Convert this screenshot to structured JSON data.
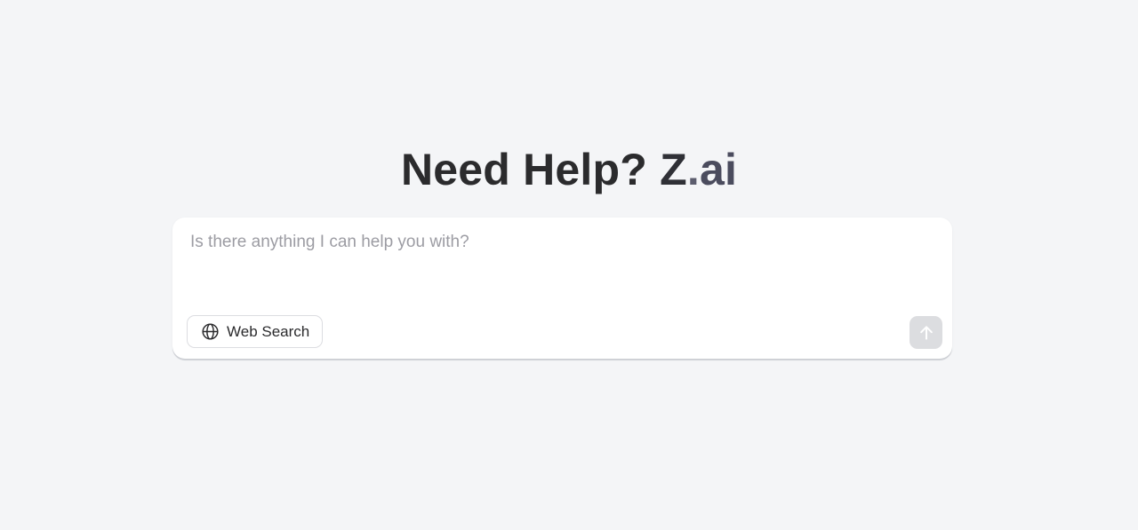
{
  "hero": {
    "title_prefix": "Need Help? ",
    "brand_z": "Z",
    "brand_dot": ".",
    "brand_ai": "ai"
  },
  "composer": {
    "placeholder": "Is there anything I can help you with?",
    "value": "",
    "web_search_label": "Web Search",
    "web_search_icon": "globe-icon",
    "send_icon": "arrow-up-icon"
  },
  "colors": {
    "background": "#f4f5f7",
    "title": "#2b2b2d",
    "brand_dot": "#5c5d6e",
    "send_button_disabled": "#dcdde0"
  }
}
